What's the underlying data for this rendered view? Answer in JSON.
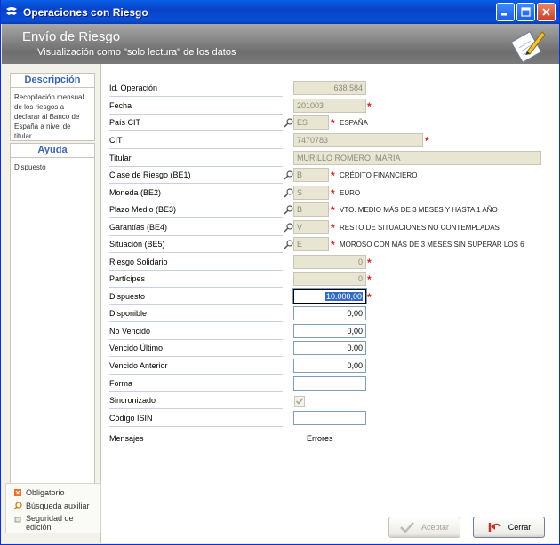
{
  "window": {
    "title": "Operaciones con Riesgo"
  },
  "header": {
    "title": "Envío de Riesgo",
    "subtitle": "Visualización como \"solo lectura\" de los datos"
  },
  "sidebar": {
    "descripcion_title": "Descripción",
    "descripcion_text": "Recopilación mensual de los riesgos a declarar al Banco de España a nivel de titular.",
    "ayuda_title": "Ayuda",
    "ayuda_text": "Dispuesto"
  },
  "legend": {
    "obligatorio": "Obligatorio",
    "busqueda": "Búsqueda auxiliar",
    "seguridad": "Seguridad de edición"
  },
  "form": {
    "id_operacion": {
      "label": "Id. Operación",
      "value": "638.584"
    },
    "fecha": {
      "label": "Fecha",
      "value": "201003"
    },
    "pais_cit": {
      "label": "País CIT",
      "value": "ES",
      "desc": "ESPAÑA"
    },
    "cit": {
      "label": "CIT",
      "value": "7470783"
    },
    "titular": {
      "label": "Titular",
      "value": "MURILLO ROMERO, MARÍA"
    },
    "clase_riesgo": {
      "label": "Clase de Riesgo (BE1)",
      "value": "B",
      "desc": "CRÉDITO FINANCIERO"
    },
    "moneda": {
      "label": "Moneda (BE2)",
      "value": "S",
      "desc": "EURO"
    },
    "plazo_medio": {
      "label": "Plazo Medio (BE3)",
      "value": "B",
      "desc": "VTO. MEDIO MÁS DE 3 MESES Y HASTA 1 AÑO"
    },
    "garantias": {
      "label": "Garantías (BE4)",
      "value": "V",
      "desc": "RESTO DE SITUACIONES NO CONTEMPLADAS"
    },
    "situacion": {
      "label": "Situación (BE5)",
      "value": "E",
      "desc": "MOROSO CON MÁS DE 3 MESES SIN SUPERAR LOS 6"
    },
    "riesgo_solidario": {
      "label": "Riesgo Solidario",
      "value": "0"
    },
    "participes": {
      "label": "Partícipes",
      "value": "0"
    },
    "dispuesto": {
      "label": "Dispuesto",
      "value": "10.000,00"
    },
    "disponible": {
      "label": "Disponible",
      "value": "0,00"
    },
    "no_vencido": {
      "label": "No Vencido",
      "value": "0,00"
    },
    "vencido_ultimo": {
      "label": "Vencido Último",
      "value": "0,00"
    },
    "vencido_anterior": {
      "label": "Vencido Anterior",
      "value": "0,00"
    },
    "forma": {
      "label": "Forma",
      "value": ""
    },
    "sincronizado": {
      "label": "Sincronizado"
    },
    "codigo_isin": {
      "label": "Código ISIN",
      "value": ""
    },
    "mensajes_label": "Mensajes",
    "errores_label": "Errores"
  },
  "buttons": {
    "aceptar": "Aceptar",
    "cerrar": "Cerrar"
  },
  "colors": {
    "titlebar": "#0A4FD8",
    "required": "#D82323",
    "label_underline": "#C7CFE0",
    "readonly_field": "#E8E5D2"
  }
}
